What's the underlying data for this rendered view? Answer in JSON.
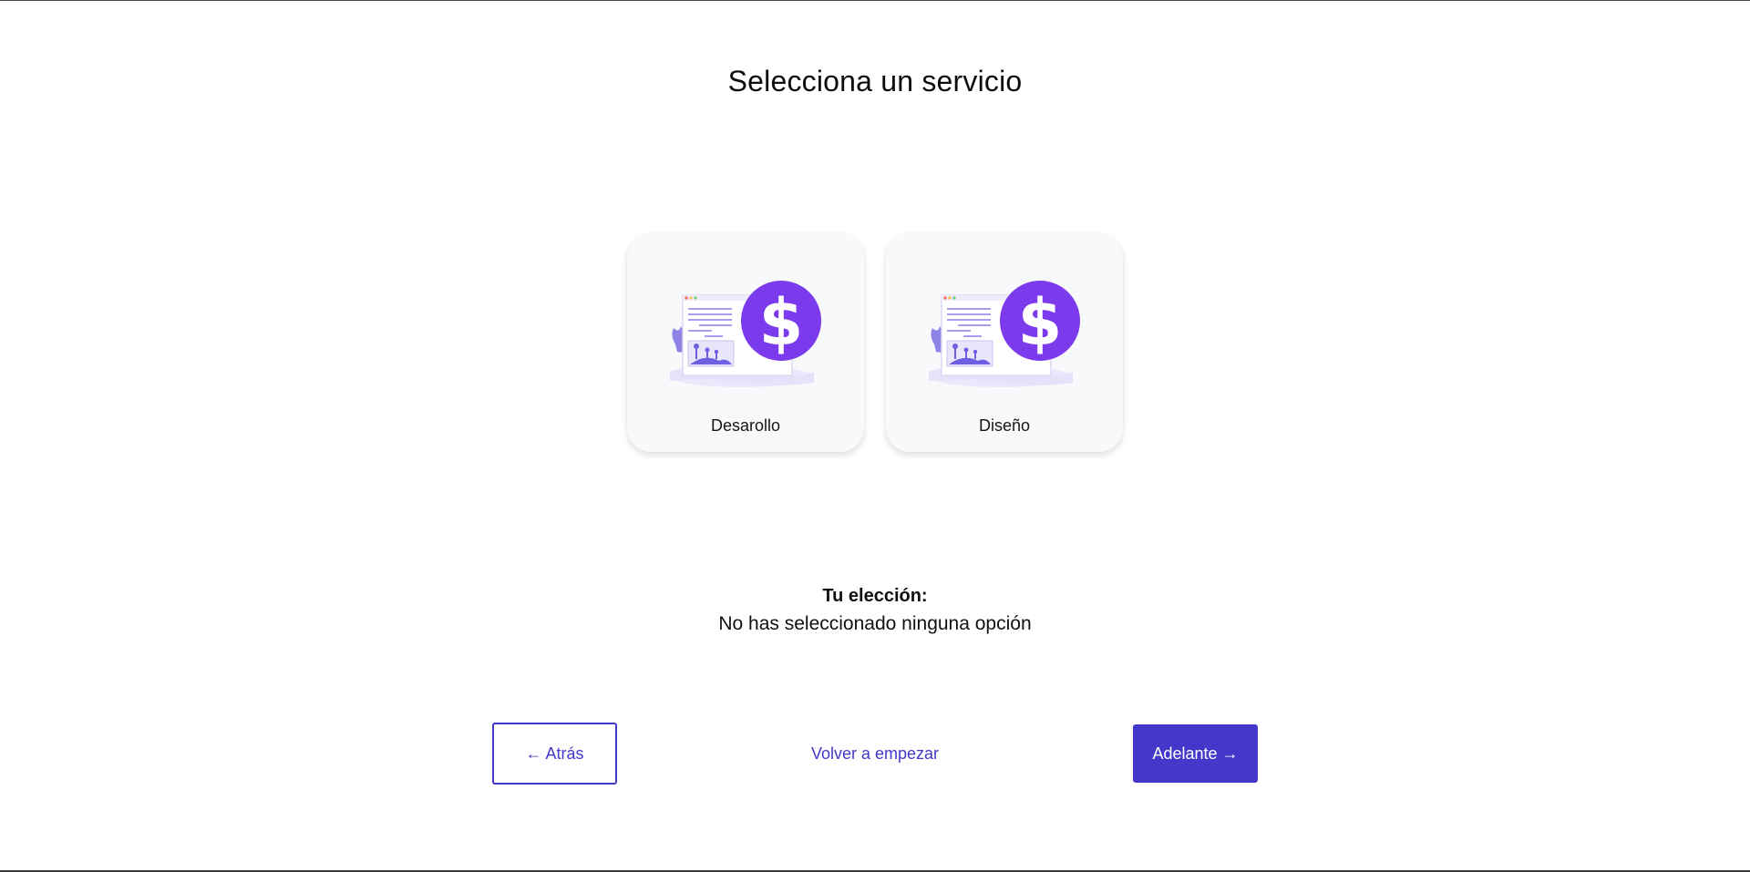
{
  "page": {
    "title": "Selecciona un servicio"
  },
  "services": [
    {
      "label": "Desarollo",
      "icon": "dollar-coin-illustration"
    },
    {
      "label": "Diseño",
      "icon": "dollar-coin-illustration"
    }
  ],
  "selection": {
    "heading": "Tu elección:",
    "value": "No has seleccionado ninguna opción"
  },
  "navigation": {
    "back_label": "← Atrás",
    "restart_label": "Volver a empezar",
    "next_label": "Adelante →"
  },
  "colors": {
    "accent": "#4338ca",
    "coin": "#7c3aed",
    "illustration_light": "#c7c2f5",
    "card_background": "#f8f9fb"
  }
}
